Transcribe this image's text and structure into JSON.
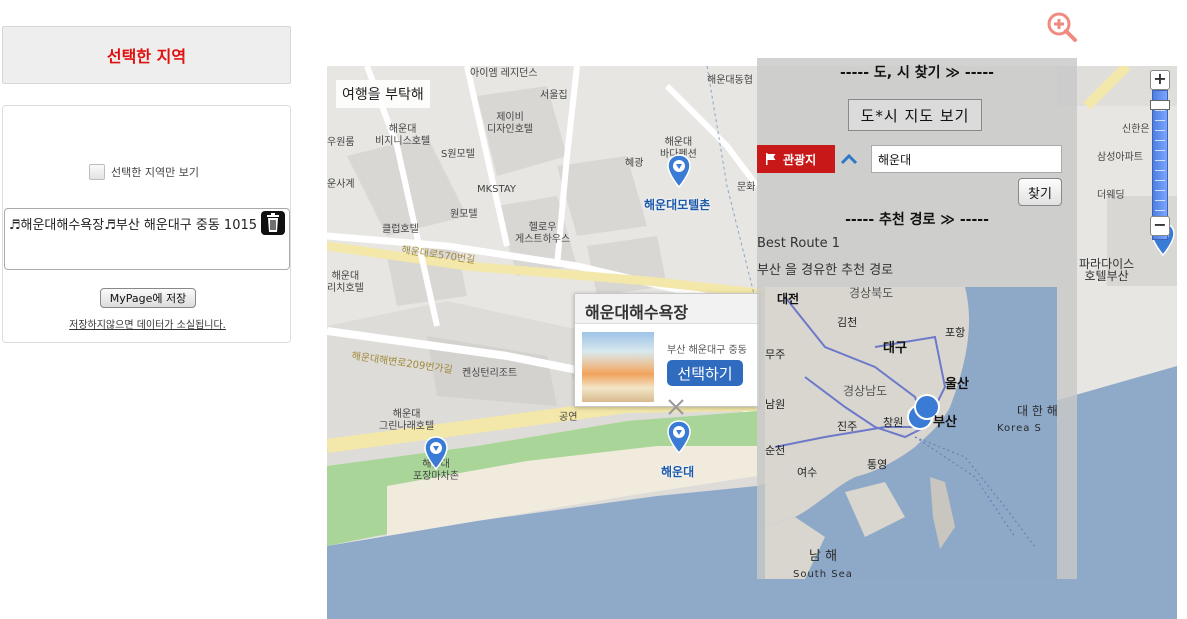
{
  "sidebar": {
    "header": "선택한 지역",
    "only_selected_label": "선택한 지역만 보기",
    "selected_text": "♬해운대해수욕장♬부산 해운대구 중동 1015",
    "mypage_button": "MyPage에 저장",
    "warning": "저장하지않으면 데이터가 소실됩니다."
  },
  "map": {
    "travel_tag": "여행을 부탁해",
    "labels": {
      "aim": "아이엠\n레지던스",
      "seoul": "서울집",
      "ht_dong": "해운대동협",
      "biz": "해운대\n비지니스호텔",
      "jeibi": "제이비\n디자인호텔",
      "smotel": "S원모텔",
      "hyegwang": "혜광",
      "baedal": "해운대\n바다펜션",
      "munhwa": "문화",
      "mkstay": "MKSTAY",
      "wonmotel": "원모텔",
      "club": "클럽호텔",
      "hello": "헬로우\n게스트하우스",
      "ht_motel": "해운대모텔촌",
      "road1": "해운대로570번길",
      "road2": "해운대해변로209번가길",
      "ht_hotel": "해운대\n리치호텔",
      "kensing": "켄싱턴리조트",
      "gongyeon": "공연",
      "green": "해운대\n그린나래호텔",
      "pocha": "해운대\n포장마차촌",
      "haeundae": "해운대",
      "wonryu": "우원룸",
      "sagye": "운사계",
      "paradise": "파라다이스\n호텔부산",
      "samsung": "삼성아파트",
      "shinhan": "신한은",
      "wedding": "더웨딩"
    }
  },
  "popup": {
    "title": "해운대해수욕장",
    "address": "부산 해운대구 중동",
    "select_button": "선택하기"
  },
  "overlay": {
    "title1": "----- 도, 시 찾기 ≫ -----",
    "map_button": "도*시 지도 보기",
    "category": "관광지",
    "search_value": "해운대",
    "find_button": "찾기",
    "title2": "----- 추천 경로 ≫ -----",
    "route_name": "Best Route 1",
    "route_desc": "부산 을 경유한 추천 경로",
    "minimap": {
      "daejeon": "대전",
      "gyeongbuk": "경상북도",
      "gimcheon": "김천",
      "pohang": "포항",
      "daegu": "대구",
      "ulsan": "울산",
      "gyeongnam": "경상남도",
      "changwon": "창원",
      "busan": "부산",
      "jinju": "진주",
      "tongyeong": "통영",
      "yeosu": "여수",
      "namhae": "남 해",
      "korea": "대 한 해",
      "korea_en": "Korea S",
      "south_sea": "South Sea",
      "namwon": "남원",
      "suncheon": "순천",
      "muju": "무주"
    }
  }
}
